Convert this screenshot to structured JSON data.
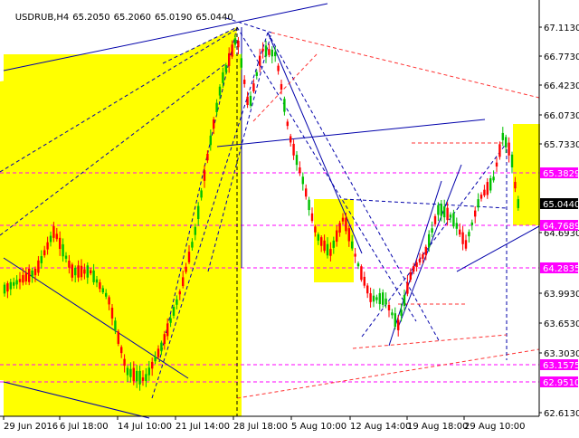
{
  "header": {
    "symbol": "USDRUB,H4",
    "open": "65.2050",
    "high": "65.2060",
    "low": "65.0190",
    "close": "65.0440"
  },
  "colors": {
    "background": "#ffffff",
    "highlight_zone": "#ffff00",
    "bull_candle": "#00c000",
    "bear_candle": "#ff0000",
    "trend_line": "#0000aa",
    "level_line": "#ff00ff",
    "channel_line": "#ff3333",
    "price_tag": "#ff00ff",
    "current_price_tag": "#000000"
  },
  "y_axis": {
    "ticks": [
      "67.1130",
      "66.7730",
      "66.4230",
      "66.0730",
      "65.7330",
      "65.3829",
      "65.0440",
      "64.6930",
      "64.7689",
      "64.2835",
      "63.9930",
      "63.6530",
      "63.3030",
      "63.1575",
      "62.9510",
      "62.6130"
    ],
    "min": 62.613,
    "max": 67.113
  },
  "price_levels": [
    {
      "label": "65.3829",
      "value": 65.3829,
      "kind": "level"
    },
    {
      "label": "64.7689",
      "value": 64.7689,
      "kind": "level"
    },
    {
      "label": "64.2835",
      "value": 64.2835,
      "kind": "level"
    },
    {
      "label": "63.1575",
      "value": 63.1575,
      "kind": "level"
    },
    {
      "label": "62.9510",
      "value": 62.951,
      "kind": "level"
    },
    {
      "label": "65.0440",
      "value": 65.044,
      "kind": "current"
    }
  ],
  "x_axis": {
    "labels": [
      "29 Jun 2016",
      "6 Jul 18:00",
      "14 Jul 10:00",
      "21 Jul 14:00",
      "28 Jul 18:00",
      "5 Aug 10:00",
      "12 Aug 14:00",
      "19 Aug 18:00",
      "29 Aug 10:00"
    ]
  }
}
